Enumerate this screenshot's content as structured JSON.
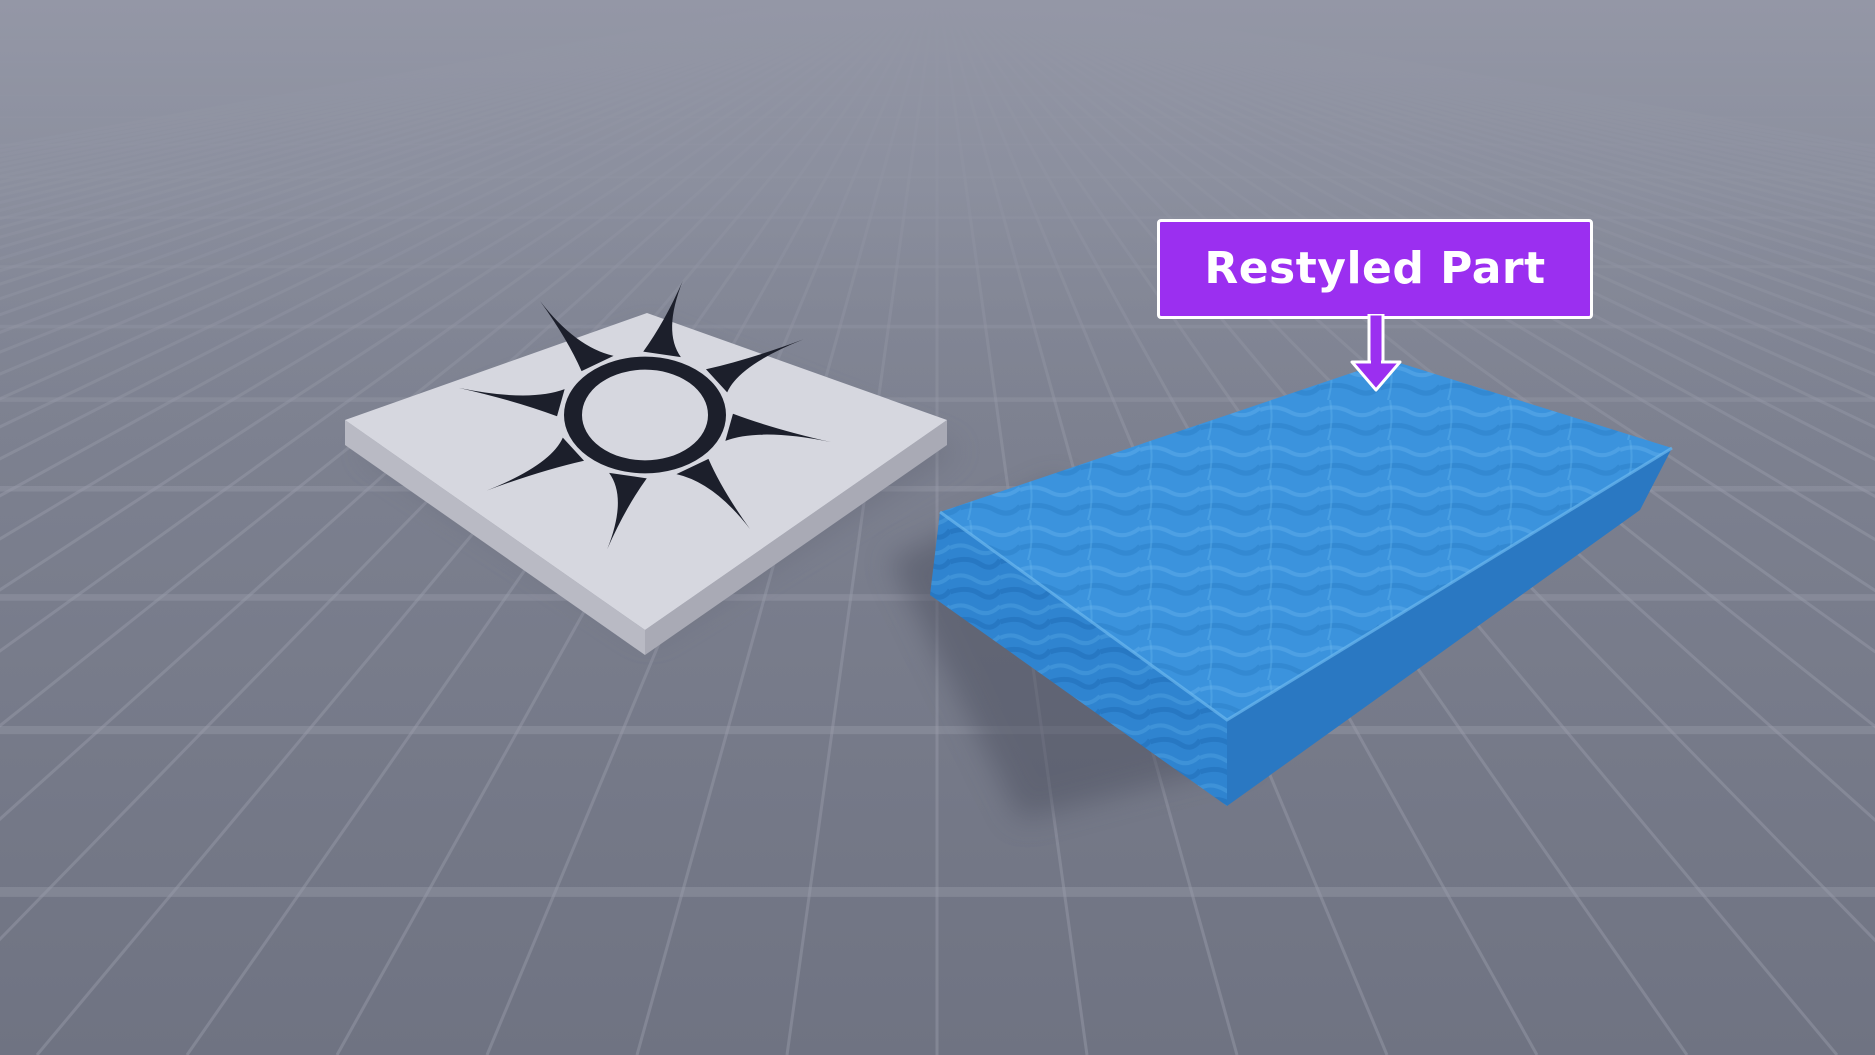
{
  "scene": {
    "title": "",
    "floor_color": "#7d8190",
    "grid_line_color": "#9a9dab",
    "fog_color": "#9497a6"
  },
  "parts": {
    "decal_part": {
      "top_color": "#d6d7df",
      "side_color": "#b9bac4",
      "decal_icon": "sun-decal-icon",
      "decal_color": "#1c1f2b"
    },
    "restyled_part": {
      "top_color": "#3b93dd",
      "side_color": "#2d7fcc",
      "material_icon": "fabric-texture-icon"
    }
  },
  "callout": {
    "label": "Restyled Part",
    "color": "#9b2ff0",
    "border_color": "#ffffff",
    "arrow_icon": "arrow-down-icon"
  }
}
